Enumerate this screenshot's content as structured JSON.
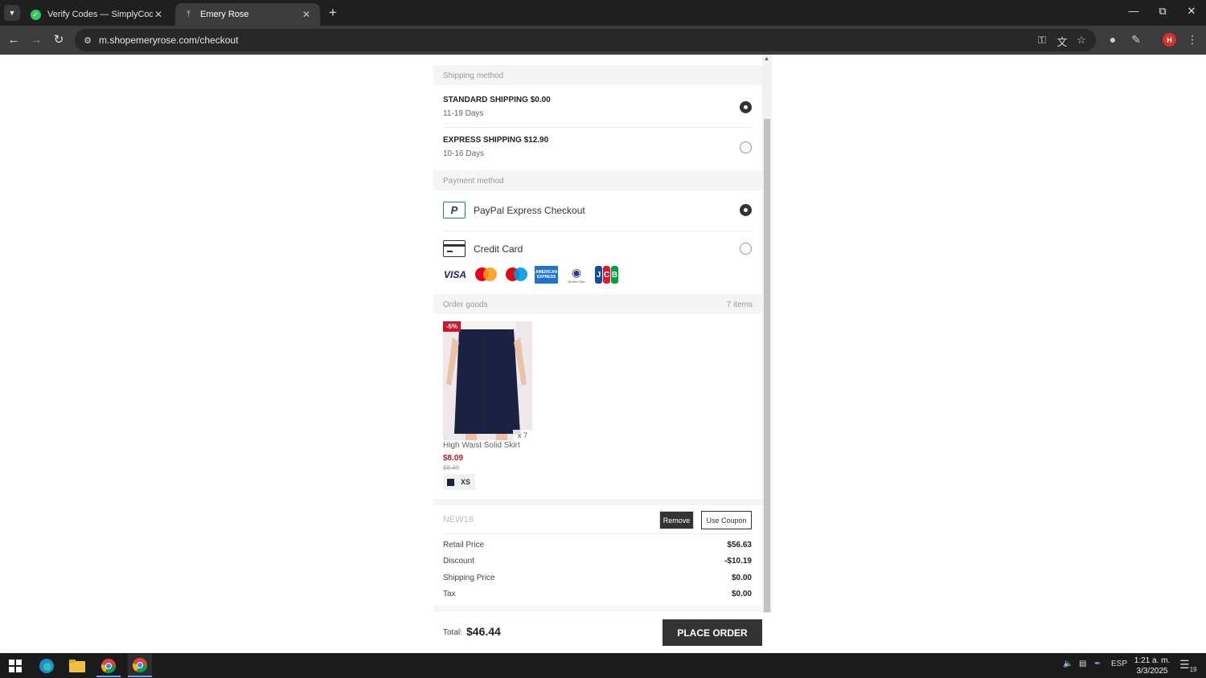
{
  "browser": {
    "tabs": [
      {
        "title": "Verify Codes — SimplyCodes",
        "active": false
      },
      {
        "title": "Emery Rose",
        "active": true
      }
    ],
    "url": "m.shopemeryrose.com/checkout",
    "profile_initial": "H"
  },
  "checkout": {
    "shipping_method_label": "Shipping method",
    "shipping_options": [
      {
        "name": "STANDARD SHIPPING $0.00",
        "eta": "11-19 Days",
        "selected": true
      },
      {
        "name": "EXPRESS SHIPPING $12.90",
        "eta": "10-16 Days",
        "selected": false
      }
    ],
    "payment_method_label": "Payment method",
    "payment_options": [
      {
        "name": "PayPal Express Checkout",
        "icon": "paypal-icon",
        "selected": true
      },
      {
        "name": "Credit Card",
        "icon": "credit-card-icon",
        "selected": false
      }
    ],
    "card_brands": {
      "visa": "VISA",
      "mastercard": "mastercard",
      "maestro": "maestro",
      "amex": "AMERICAN EXPRESS",
      "diners": "Diners Club",
      "jcb": [
        "J",
        "C",
        "B"
      ]
    },
    "order_goods_label": "Order goods",
    "item_count": "7 items",
    "product": {
      "name": "High Waist Solid Skirt",
      "price": "$8.09",
      "original_price": "$8.49",
      "discount": "-5%",
      "quantity": "x 7",
      "size": "XS",
      "color_hex": "#1b2140"
    },
    "coupon": {
      "code": "NEW18",
      "remove_label": "Remove",
      "use_label": "Use Coupon"
    },
    "summary": [
      {
        "label": "Retail Price",
        "value": "$56.63"
      },
      {
        "label": "Discount",
        "value": "-$10.19"
      },
      {
        "label": "Shipping Price",
        "value": "$0.00"
      },
      {
        "label": "Tax",
        "value": "$0.00"
      }
    ],
    "total_label": "Total:",
    "total_value": "$46.44",
    "place_order_label": "PLACE ORDER"
  },
  "taskbar": {
    "language": "ESP",
    "time": "1:21 a. m.",
    "date": "3/3/2025",
    "notification_count": "19"
  },
  "colors": {
    "accent_dark": "#333333",
    "price_red": "#c8102e",
    "discount_red": "#d0142c"
  }
}
